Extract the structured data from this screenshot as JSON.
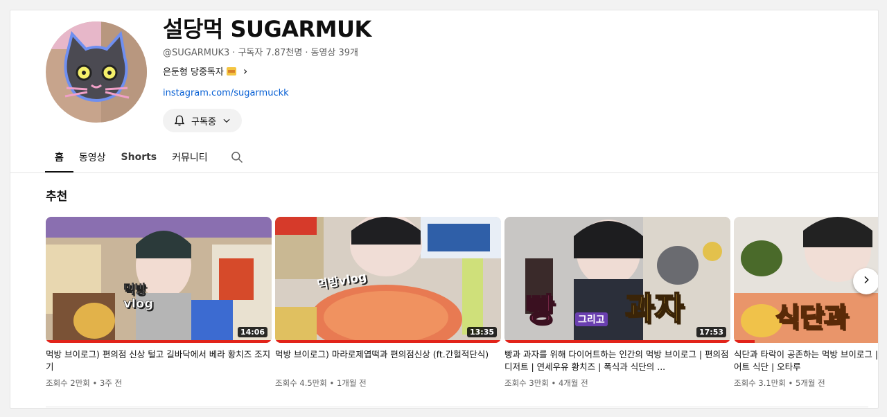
{
  "channel": {
    "title": "설당먹 SUGARMUK",
    "handle": "@SUGARMUK3",
    "subscribers": "구독자 7.87천명",
    "video_count": "동영상 39개",
    "description": "은둔형 당중독자",
    "link": "instagram.com/sugarmuckk",
    "subscribe_label": "구독중"
  },
  "tabs": [
    {
      "label": "홈"
    },
    {
      "label": "동영상"
    },
    {
      "label": "Shorts"
    },
    {
      "label": "커뮤니티"
    }
  ],
  "section": {
    "title": "추천"
  },
  "videos": [
    {
      "title": "먹방 브이로그) 편의점 신상 털고 길바닥에서 베라 황치즈 조지기",
      "views": "조회수 2만회",
      "age": "3주 전",
      "duration": "14:06",
      "overlay": "먹방 vlog"
    },
    {
      "title": "먹방 브이로그) 마라로제엽떡과 편의점신상 (ft.간헐적단식)",
      "views": "조회수 4.5만회",
      "age": "1개월 전",
      "duration": "13:35",
      "overlay": "먹방vlog"
    },
    {
      "title": "빵과 과자를 위해 다이어트하는 인간의 먹방 브이로그 | 편의점 디저트 | 연세우유 황치즈 | 폭식과 식단의 ...",
      "views": "조회수 3만회",
      "age": "4개월 전",
      "duration": "17:53",
      "overlay_a": "빵",
      "overlay_b": "그리고",
      "overlay_c": "과자"
    },
    {
      "title": "식단과 타락이 공존하는 먹방 브이로그 | 혈당 관리 | 다이어트 식단 | 오타루",
      "views": "조회수 3.1만회",
      "age": "5개월 전",
      "overlay": "식단과"
    }
  ],
  "colors": {
    "accent_red": "#e2231a",
    "link_blue": "#065fd4",
    "text_secondary": "#606060"
  },
  "icons": [
    "bell-icon",
    "chevron-down-icon",
    "search-icon",
    "chevron-right-icon"
  ]
}
